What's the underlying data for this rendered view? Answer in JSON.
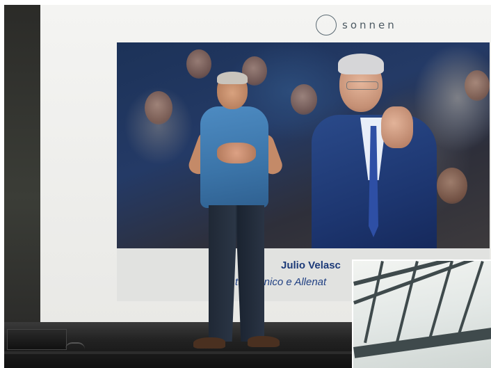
{
  "slide": {
    "logo_text": "sonnen",
    "caption_name": "Julio Velasc",
    "caption_role": "ttore  cnico e Allenat"
  },
  "colors": {
    "caption_text": "#1c3a78",
    "logo": "#4d5a63",
    "shirt": "#3b74a8"
  }
}
